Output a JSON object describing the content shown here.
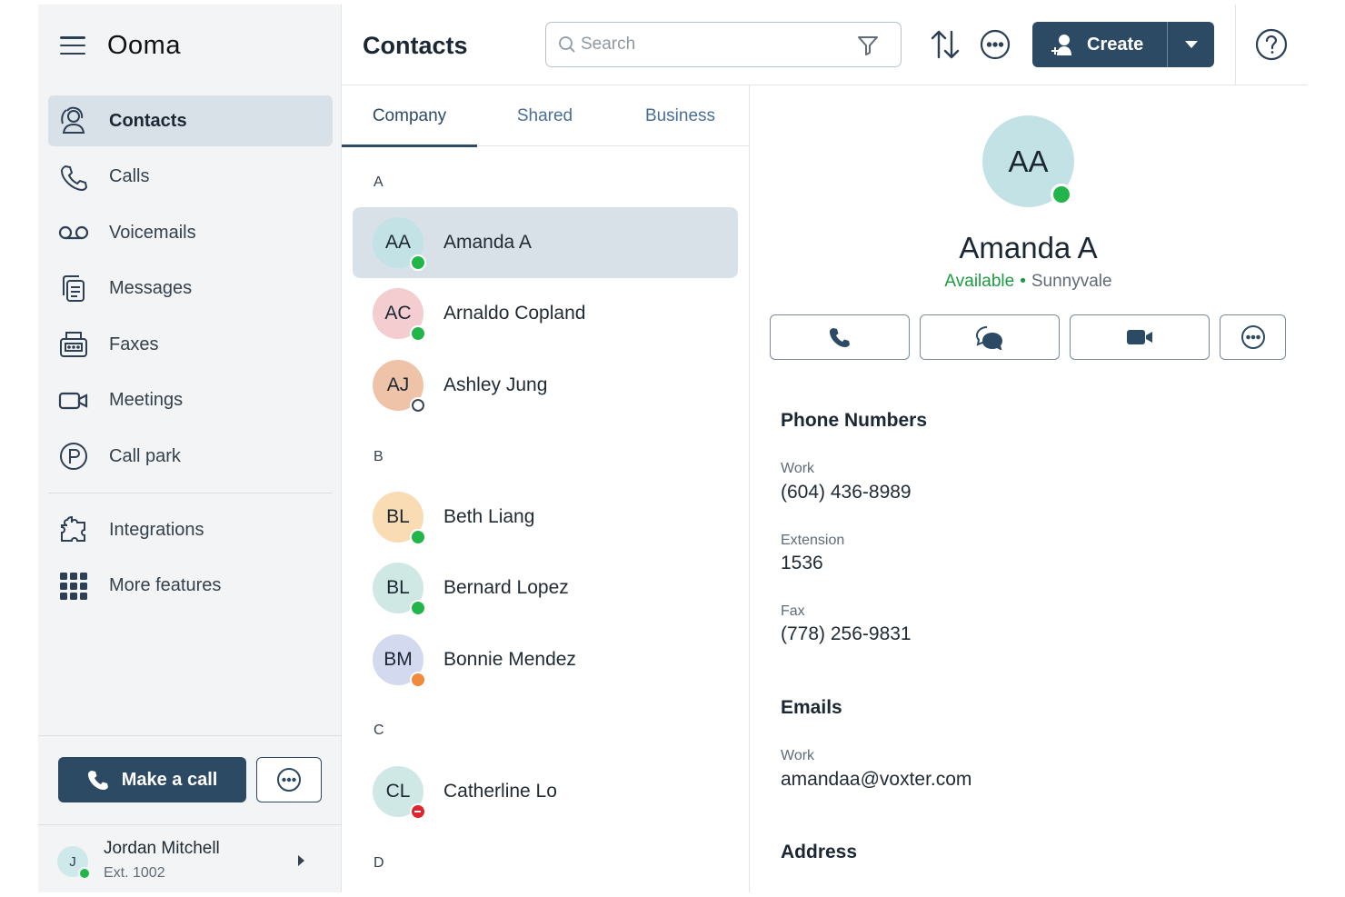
{
  "app": {
    "brand": "Ooma"
  },
  "sidebar": {
    "items": [
      {
        "label": "Contacts",
        "icon": "contacts-icon",
        "active": true
      },
      {
        "label": "Calls",
        "icon": "phone-icon"
      },
      {
        "label": "Voicemails",
        "icon": "voicemail-icon"
      },
      {
        "label": "Messages",
        "icon": "messages-icon"
      },
      {
        "label": "Faxes",
        "icon": "fax-icon"
      },
      {
        "label": "Meetings",
        "icon": "video-icon"
      },
      {
        "label": "Call park",
        "icon": "parking-icon"
      }
    ],
    "extra_items": [
      {
        "label": "Integrations",
        "icon": "puzzle-icon"
      },
      {
        "label": "More features",
        "icon": "grid-icon"
      }
    ],
    "make_call_label": "Make a call",
    "user": {
      "initial": "J",
      "name": "Jordan Mitchell",
      "ext": "Ext. 1002",
      "status": "available"
    }
  },
  "header": {
    "title": "Contacts",
    "search_placeholder": "Search",
    "create_label": "Create"
  },
  "tabs": [
    {
      "label": "Company",
      "active": true
    },
    {
      "label": "Shared"
    },
    {
      "label": "Business"
    }
  ],
  "contacts": {
    "sections": [
      {
        "letter": "A",
        "contacts": [
          {
            "initials": "AA",
            "name": "Amanda A",
            "color": "#c3e2e6",
            "status": "available",
            "selected": true
          },
          {
            "initials": "AC",
            "name": "Arnaldo Copland",
            "color": "#f3cdd0",
            "status": "available"
          },
          {
            "initials": "AJ",
            "name": "Ashley Jung",
            "color": "#efc3a8",
            "status": "offline"
          }
        ]
      },
      {
        "letter": "B",
        "contacts": [
          {
            "initials": "BL",
            "name": "Beth Liang",
            "color": "#f9dcb3",
            "status": "available"
          },
          {
            "initials": "BL",
            "name": "Bernard Lopez",
            "color": "#cfe8e3",
            "status": "available"
          },
          {
            "initials": "BM",
            "name": "Bonnie Mendez",
            "color": "#d3d9ef",
            "status": "oncall"
          }
        ]
      },
      {
        "letter": "C",
        "contacts": [
          {
            "initials": "CL",
            "name": "Catherline Lo",
            "color": "#cfe8e6",
            "status": "dnd"
          }
        ]
      },
      {
        "letter": "D",
        "contacts": []
      }
    ]
  },
  "detail": {
    "initials": "AA",
    "name": "Amanda A",
    "availability": "Available",
    "separator": "•",
    "location": "Sunnyvale",
    "phone_section": "Phone Numbers",
    "work_label": "Work",
    "work_phone": "(604) 436-8989",
    "extension_label": "Extension",
    "extension": "1536",
    "fax_label": "Fax",
    "fax": "(778) 256-9831",
    "emails_section": "Emails",
    "email_label": "Work",
    "email": "amandaa@voxter.com",
    "address_section": "Address"
  },
  "colors": {
    "accent": "#2c4a64",
    "available": "#22b54a",
    "selected_bg": "#d9e1e8"
  }
}
